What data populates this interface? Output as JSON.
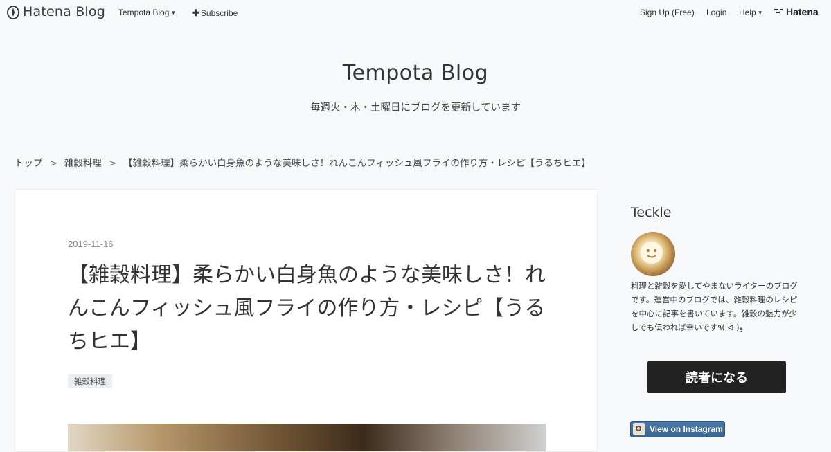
{
  "globalbar": {
    "logo_text": "Hatena Blog",
    "blog_menu": "Tempota Blog",
    "subscribe": "Subscribe",
    "signup": "Sign Up (Free)",
    "login": "Login",
    "help": "Help",
    "hatena_logo": "Hatena"
  },
  "blog": {
    "title": "Tempota Blog",
    "description": "毎週火・木・土曜日にブログを更新しています"
  },
  "breadcrumb": {
    "items": [
      "トップ",
      "雑穀料理",
      "【雑穀料理】柔らかい白身魚のような美味しさ！れんこんフィッシュ風フライの作り方・レシピ【うるちヒエ】"
    ],
    "separator": ">"
  },
  "article": {
    "date": "2019-11-16",
    "title": "【雑穀料理】柔らかい白身魚のような美味しさ！れんこんフィッシュ風フライの作り方・レシピ【うるちヒエ】",
    "category": "雑穀料理"
  },
  "sidebar": {
    "profile_name": "Teckle",
    "description": "料理と雑穀を愛してやまないライターのブログです。運営中のブログでは、雑穀料理のレシピを中心に記事を書いています。雑穀の魅力が少しでも伝われば幸いです٩( ᐛ )و",
    "follow_button": "読者になる",
    "instagram_button": "View on Instagram"
  },
  "colors": {
    "background": "#f7f8fa",
    "follow_button_bg": "#222222",
    "instagram_button_bg": "#3a6592"
  }
}
